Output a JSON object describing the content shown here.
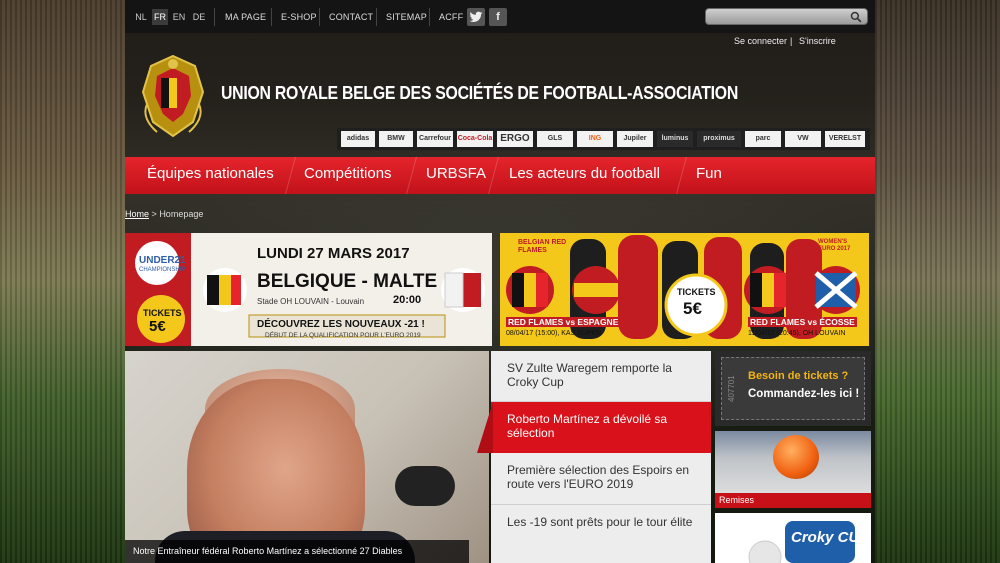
{
  "topbar": {
    "languages": [
      "NL",
      "FR",
      "EN",
      "DE"
    ],
    "active_language": "FR",
    "links": [
      "MA PAGE",
      "E-SHOP",
      "CONTACT",
      "SITEMAP",
      "ACFF"
    ],
    "social": [
      "twitter-icon",
      "facebook-icon"
    ],
    "search_value": "",
    "login": "Se connecter",
    "login_separator": "|",
    "register": "S'inscrire"
  },
  "header": {
    "title": "UNION ROYALE BELGE DES SOCIÉTÉS DE FOOTBALL-ASSOCIATION",
    "logo_text": "URBSFA KBVB",
    "sponsors": [
      "adidas",
      "BMW",
      "Carrefour",
      "Coca-Cola",
      "ERGO",
      "GLS",
      "ING",
      "Jupiler",
      "luminus",
      "proximus",
      "parc",
      "VW",
      "VERELST"
    ]
  },
  "nav": {
    "items": [
      "Équipes nationales",
      "Compétitions",
      "URBSFA",
      "Les acteurs du football",
      "Fun"
    ]
  },
  "breadcrumb": {
    "home": "Home",
    "separator": ">",
    "current": "Homepage"
  },
  "banner_u21": {
    "badge": "UNDER21",
    "badge_sub": "CHAMPIONSHIP",
    "date": "LUNDI 27 MARS 2017",
    "match": "BELGIQUE - MALTE",
    "venue": "Stade OH LOUVAIN - Louvain",
    "time": "20:00",
    "sub": "DÉBUT DE LA QUALIFICATION POUR L'EURO 2019",
    "tickets": "TICKETS",
    "price": "5€",
    "cta": "DÉCOUVREZ LES NOUVEAUX -21 !"
  },
  "banner_rf": {
    "brand": "BELGIAN RED FLAMES",
    "tickets": "TICKETS",
    "price": "5€",
    "match1": "RED FLAMES vs ESPAGNE",
    "match1_info": "08/04/17 (15:00), KAS EUPEN",
    "match2": "RED FLAMES vs ÉCOSSE",
    "match2_info": "11/04/17 (20:45), OH LOUVAIN",
    "euro": "WOMEN'S EURO 2017"
  },
  "feature": {
    "caption": "Notre Entraîneur fédéral Roberto Martínez a sélectionné 27 Diables"
  },
  "news": [
    {
      "title": "SV Zulte Waregem remporte la Croky Cup",
      "active": false
    },
    {
      "title": "Roberto Martínez a dévoilé sa sélection",
      "active": true
    },
    {
      "title": "Première sélection des Espoirs en route vers l'EURO 2019",
      "active": false
    },
    {
      "title": "Les -19 sont prêts pour le tour élite",
      "active": false
    }
  ],
  "sidebar": {
    "tickets_line1": "Besoin de tickets ?",
    "tickets_line2": "Commandez-les ici !",
    "ticket_stub": "407701",
    "remises": "Remises",
    "croky": "Croky CUP"
  },
  "colors": {
    "brand_red": "#d9111a",
    "nav_red": "#e5242c",
    "ticket_gold": "#f2b414"
  }
}
